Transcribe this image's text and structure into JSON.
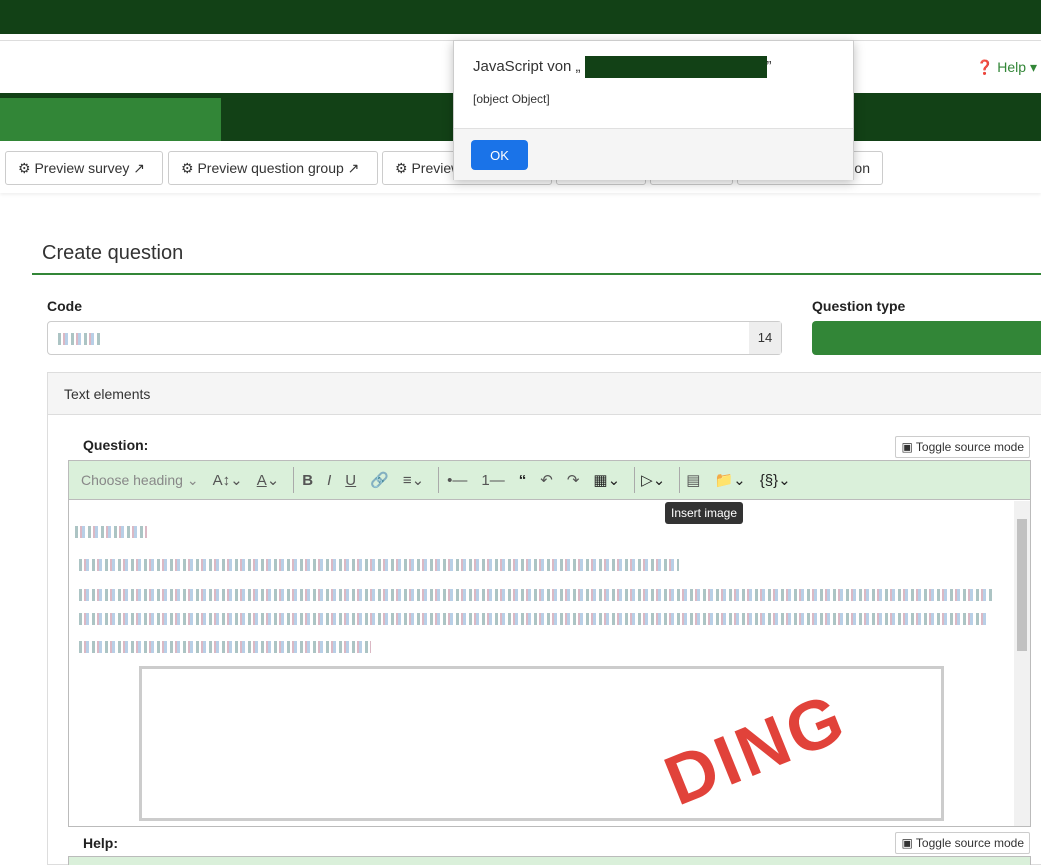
{
  "navbar": {
    "help": "Help"
  },
  "toolbar": {
    "buttons": [
      "Preview survey",
      "Preview question group",
      "Preview question",
      "",
      "",
      "",
      "Import question"
    ]
  },
  "page": {
    "title": "Create question",
    "code_label": "Code",
    "code_count": "14",
    "question_type_label": "Question type",
    "panel_title": "Text elements"
  },
  "editor": {
    "question_label": "Question:",
    "help_label": "Help:",
    "toggle_source": "Toggle source mode",
    "heading_select": "Choose heading",
    "tooltip": "Insert image",
    "stamp_text": "PENDING"
  },
  "dialog": {
    "title": "JavaScript von „",
    "title_end": "”",
    "message": "[object Object]",
    "ok": "OK"
  }
}
